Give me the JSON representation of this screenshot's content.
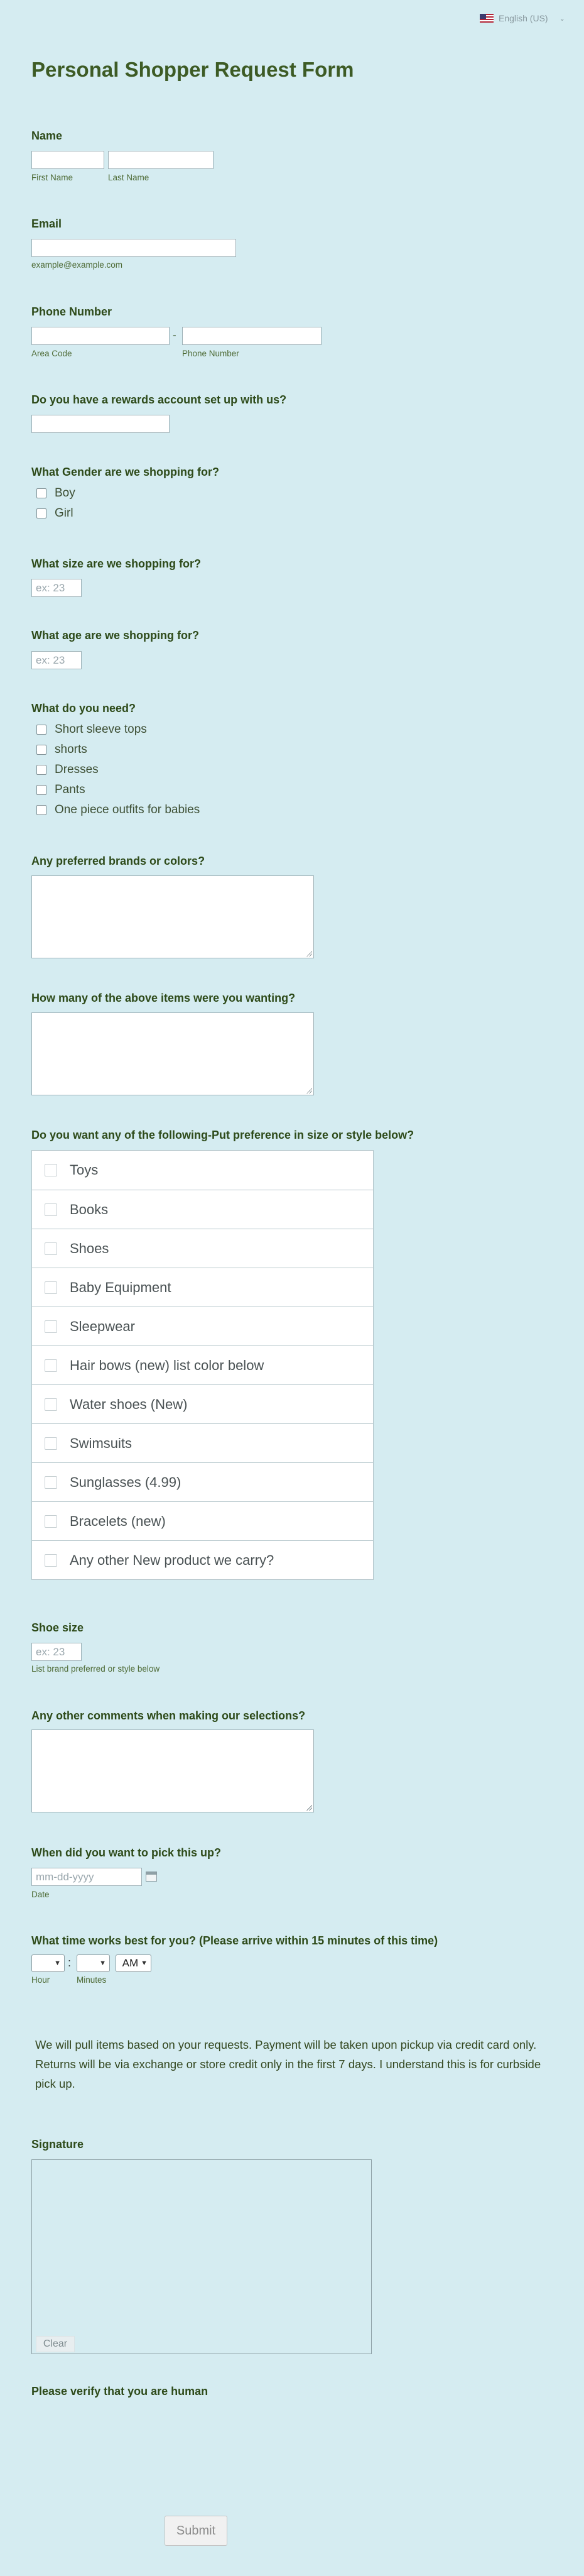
{
  "language": {
    "label": "English (US)",
    "icon": "us-flag-icon"
  },
  "form": {
    "title": "Personal Shopper Request Form",
    "name": {
      "label": "Name",
      "first_sub": "First Name",
      "last_sub": "Last Name",
      "first_value": "",
      "last_value": ""
    },
    "email": {
      "label": "Email",
      "sub": "example@example.com",
      "value": ""
    },
    "phone": {
      "label": "Phone Number",
      "separator": "-",
      "area_sub": "Area Code",
      "number_sub": "Phone Number"
    },
    "rewards": {
      "label": "Do you have a rewards account set up with us?",
      "value": ""
    },
    "gender": {
      "label": "What Gender are we shopping for?",
      "options": [
        "Boy",
        "Girl"
      ]
    },
    "size": {
      "label": "What size are we shopping for?",
      "placeholder": "ex: 23"
    },
    "age": {
      "label": "What age are we shopping for?",
      "placeholder": "ex: 23"
    },
    "needs": {
      "label": "What do you need?",
      "options": [
        "Short sleeve tops",
        "shorts",
        "Dresses",
        "Pants",
        "One piece outfits for babies"
      ]
    },
    "brands": {
      "label": "Any preferred brands or colors?"
    },
    "quantity": {
      "label": "How many of the above items were you wanting?"
    },
    "wants": {
      "label": "Do you want any of the following-Put preference in size or style below?",
      "options": [
        "Toys",
        "Books",
        "Shoes",
        "Baby Equipment",
        "Sleepwear",
        "Hair bows (new) list color below",
        "Water shoes (New)",
        "Swimsuits",
        "Sunglasses (4.99)",
        "Bracelets (new)",
        "Any other New product we carry?"
      ]
    },
    "shoe_size": {
      "label": "Shoe size",
      "placeholder": "ex: 23",
      "sub": "List brand preferred or style below"
    },
    "comments": {
      "label": "Any other comments when making our selections?"
    },
    "pickup_date": {
      "label": "When did you want to pick this up?",
      "placeholder": "mm-dd-yyyy",
      "sub": "Date"
    },
    "pickup_time": {
      "label": "What time works best for you? (Please arrive within 15 minutes of this time)",
      "hour_sub": "Hour",
      "minutes_sub": "Minutes",
      "separator": ":",
      "ampm_value": "AM"
    },
    "terms": "We will pull items based on your requests. Payment will be taken upon pickup via credit card only. Returns will be via exchange or store credit only in the first 7 days. I understand this is for curbside pick up.",
    "signature": {
      "label": "Signature",
      "clear_label": "Clear"
    },
    "captcha": {
      "label": "Please verify that you are human"
    },
    "submit_label": "Submit"
  }
}
